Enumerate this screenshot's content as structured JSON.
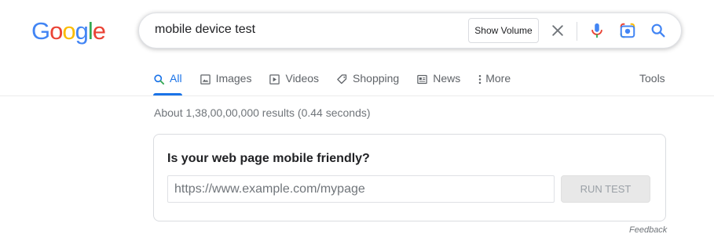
{
  "logo": {
    "letters": [
      "G",
      "o",
      "o",
      "g",
      "l",
      "e"
    ],
    "colors": [
      "#4285F4",
      "#EA4335",
      "#FBBC05",
      "#4285F4",
      "#34A853",
      "#EA4335"
    ]
  },
  "search": {
    "query": "mobile device test",
    "show_volume_label": "Show Volume",
    "icons": [
      "clear-icon",
      "mic-icon",
      "lens-icon",
      "search-icon"
    ]
  },
  "tabs": [
    {
      "label": "All",
      "icon": "search-icon",
      "active": true
    },
    {
      "label": "Images",
      "icon": "image-icon",
      "active": false
    },
    {
      "label": "Videos",
      "icon": "play-icon",
      "active": false
    },
    {
      "label": "Shopping",
      "icon": "tag-icon",
      "active": false
    },
    {
      "label": "News",
      "icon": "news-icon",
      "active": false
    },
    {
      "label": "More",
      "icon": "more-vert-icon",
      "active": false
    }
  ],
  "tools_label": "Tools",
  "result_stats": "About 1,38,00,00,000 results (0.44 seconds)",
  "card": {
    "title": "Is your web page mobile friendly?",
    "url_placeholder": "https://www.example.com/mypage",
    "run_button_label": "RUN TEST"
  },
  "feedback_label": "Feedback",
  "colors": {
    "accent": "#1a73e8",
    "text_secondary": "#5f6368"
  }
}
